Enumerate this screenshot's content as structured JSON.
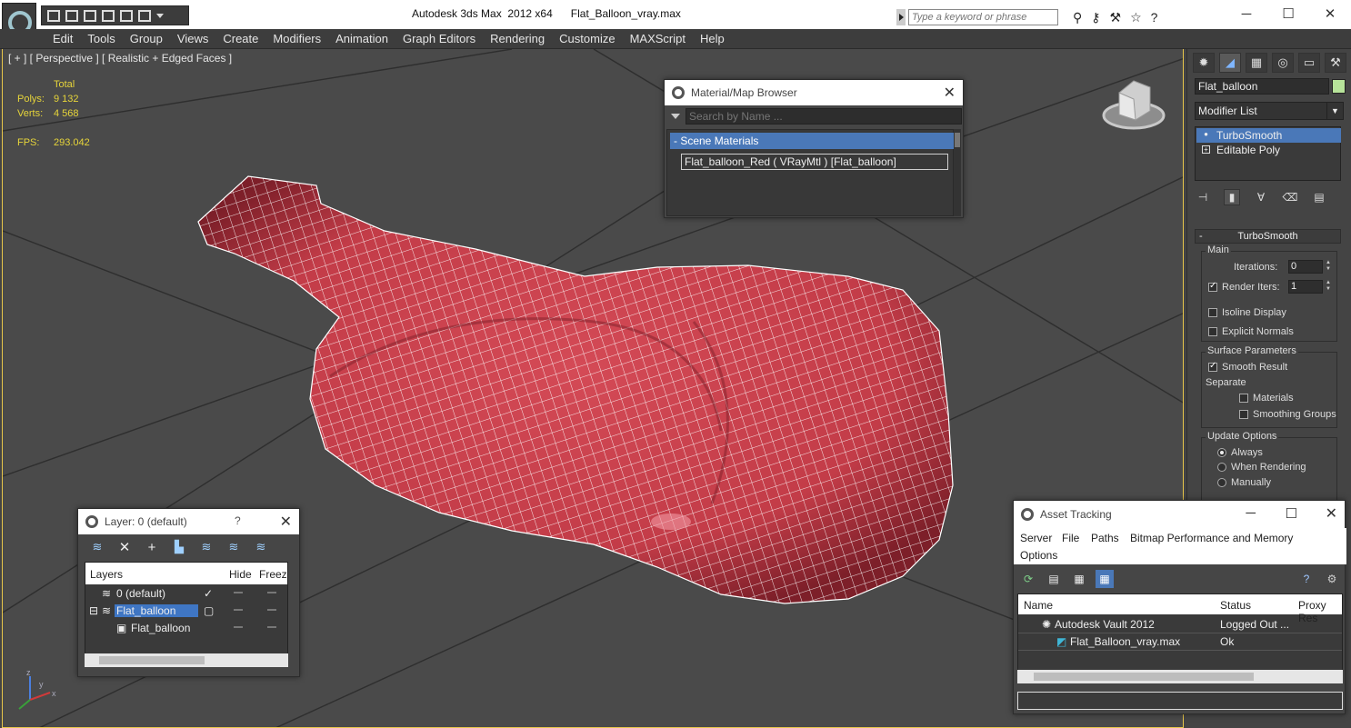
{
  "window": {
    "title": "Autodesk 3ds Max  2012 x64      Flat_Balloon_vray.max",
    "search_placeholder": "Type a keyword or phrase",
    "controls": [
      "─",
      "☐",
      "✕"
    ]
  },
  "menu": {
    "items": [
      "Edit",
      "Tools",
      "Group",
      "Views",
      "Create",
      "Modifiers",
      "Animation",
      "Graph Editors",
      "Rendering",
      "Customize",
      "MAXScript",
      "Help"
    ]
  },
  "viewport": {
    "label": "[ + ] [ Perspective ] [ Realistic + Edged Faces ]",
    "stats": {
      "total_label": "Total",
      "polys_label": "Polys:",
      "polys_value": "9 132",
      "verts_label": "Verts:",
      "verts_value": "4 568",
      "fps_label": "FPS:",
      "fps_value": "293.042"
    },
    "axes": {
      "x": "x",
      "y": "y",
      "z": "z"
    },
    "colors": {
      "mesh": "#c8414d",
      "wire": "#ffffff",
      "stats": "#e6d43a",
      "background": "#4a4a4a"
    }
  },
  "material_browser": {
    "title": "Material/Map Browser",
    "search_placeholder": "Search by Name ...",
    "category": "- Scene Materials",
    "item": "Flat_balloon_Red  ( VRayMtl ) [Flat_balloon]"
  },
  "command_panel": {
    "tabs": [
      "create",
      "modify",
      "hierarchy",
      "motion",
      "display",
      "utilities"
    ],
    "object_name": "Flat_balloon",
    "object_color": "#b7e39a",
    "modifier_list_label": "Modifier List",
    "stack": [
      "TurboSmooth",
      "Editable Poly"
    ],
    "rollout_title": "TurboSmooth",
    "main": {
      "label": "Main",
      "iterations_label": "Iterations:",
      "iterations_value": "0",
      "render_iters_label": "Render Iters:",
      "render_iters_value": "1",
      "isoline_label": "Isoline Display",
      "explicit_label": "Explicit Normals"
    },
    "surface": {
      "label": "Surface Parameters",
      "smooth_result": "Smooth Result",
      "separate": "Separate",
      "materials": "Materials",
      "smoothing_groups": "Smoothing Groups"
    },
    "update": {
      "label": "Update Options",
      "always": "Always",
      "when_rendering": "When Rendering",
      "manually": "Manually"
    }
  },
  "layer_dialog": {
    "title": "Layer: 0 (default)",
    "help": "?",
    "columns": [
      "Layers",
      "Hide",
      "Freeze"
    ],
    "rows": [
      "0 (default)",
      "Flat_balloon",
      "Flat_balloon"
    ]
  },
  "asset_tracking": {
    "title": "Asset Tracking",
    "menu": [
      "Server",
      "File",
      "Paths",
      "Bitmap Performance and Memory",
      "Options"
    ],
    "columns": [
      "Name",
      "Status",
      "Proxy Res"
    ],
    "rows": [
      {
        "name": "Autodesk Vault 2012",
        "status": "Logged Out ..."
      },
      {
        "name": "Flat_Balloon_vray.max",
        "status": "Ok"
      }
    ]
  }
}
